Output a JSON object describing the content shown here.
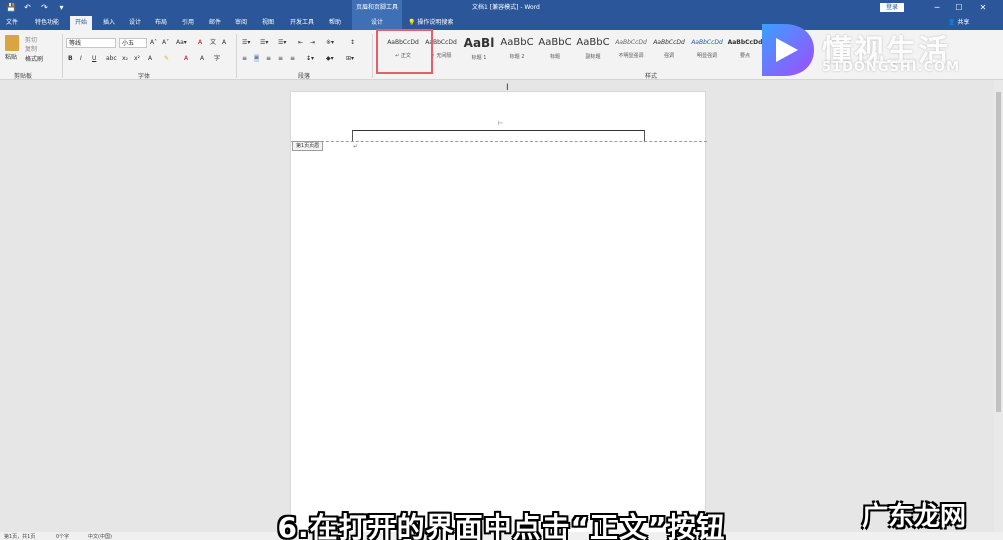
{
  "titlebar": {
    "contextual_tab": "页眉和页脚工具",
    "document_title": "文档1 [兼容模式] - Word",
    "signin": "登录",
    "controls": [
      "─",
      "☐",
      "✕"
    ]
  },
  "tabs": {
    "file": "文件",
    "special": "特色功能",
    "home": "开始",
    "insert": "插入",
    "design_main": "设计",
    "layout": "布局",
    "references": "引用",
    "mailings": "邮件",
    "review": "审阅",
    "view": "视图",
    "developer": "开发工具",
    "help": "帮助",
    "header_design": "设计",
    "tellme": "操作说明搜索",
    "share": "共享"
  },
  "ribbon": {
    "clipboard": {
      "paste": "粘贴",
      "cut": "剪切",
      "copy": "复制",
      "format_painter": "格式刷",
      "group_label": "剪贴板"
    },
    "font": {
      "name": "等线",
      "size": "小五",
      "group_label": "字体"
    },
    "paragraph": {
      "group_label": "段落"
    },
    "styles": {
      "group_label": "样式",
      "items": [
        {
          "sample": "AaBbCcDd",
          "name": "↵ 正文"
        },
        {
          "sample": "AaBbCcDd",
          "name": "↵ 无间隔"
        },
        {
          "sample": "AaBl",
          "name": "标题 1"
        },
        {
          "sample": "AaBbC",
          "name": "标题 2"
        },
        {
          "sample": "AaBbC",
          "name": "标题"
        },
        {
          "sample": "AaBbC",
          "name": "副标题"
        },
        {
          "sample": "AaBbCcDd",
          "name": "不明显强调"
        },
        {
          "sample": "AaBbCcDd",
          "name": "强调"
        },
        {
          "sample": "AaBbCcDd",
          "name": "明显强调"
        },
        {
          "sample": "AaBbCcDd",
          "name": "要点"
        }
      ]
    }
  },
  "document": {
    "header_tag": "第1页页眉",
    "para_mark": "↵"
  },
  "statusbar": {
    "page": "第1页，共1页",
    "words": "0个字",
    "lang": "中文(中国)"
  },
  "caption": "6.在打开的界面中点击“正文”按钮",
  "watermark": {
    "title": "懂视生活",
    "sub": "51DONGSHI.COM",
    "bottom_right": "广东龙网"
  },
  "colors": {
    "accent": "#2b579a",
    "highlight": "#e35f6b"
  }
}
